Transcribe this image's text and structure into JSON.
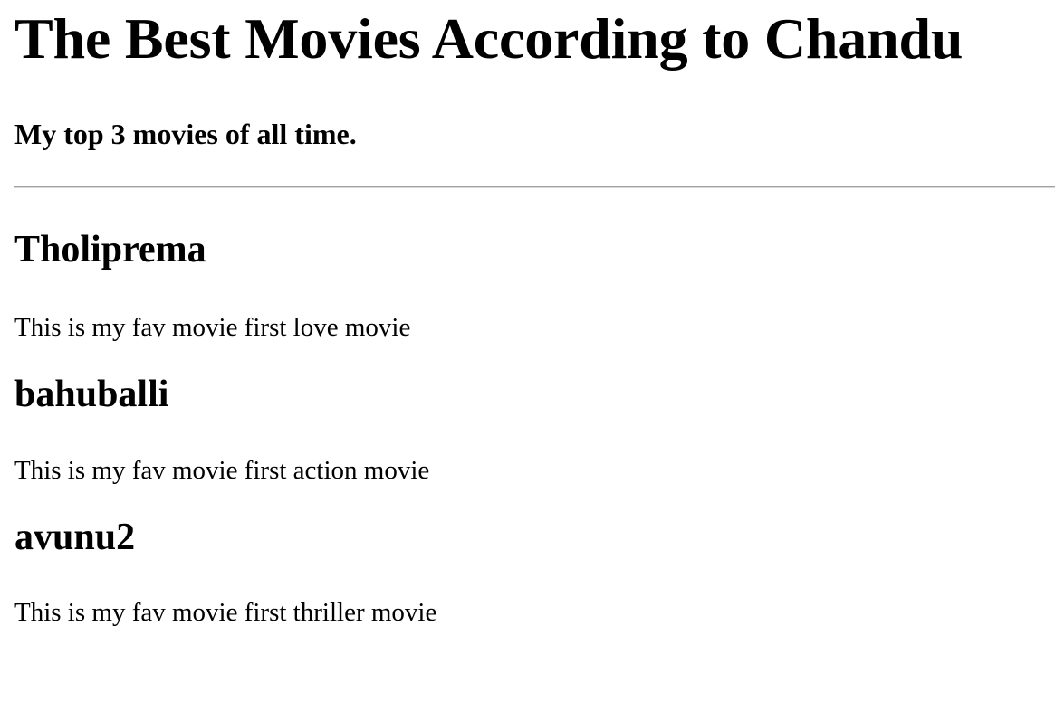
{
  "header": {
    "title": "The Best Movies According to Chandu",
    "subtitle": "My top 3 movies of all time."
  },
  "movies": [
    {
      "title": "Tholiprema",
      "description": "This is my fav movie first love movie"
    },
    {
      "title": "bahuballi",
      "description": "This is my fav movie first action movie"
    },
    {
      "title": "avunu2",
      "description": "This is my fav movie first thriller movie"
    }
  ]
}
